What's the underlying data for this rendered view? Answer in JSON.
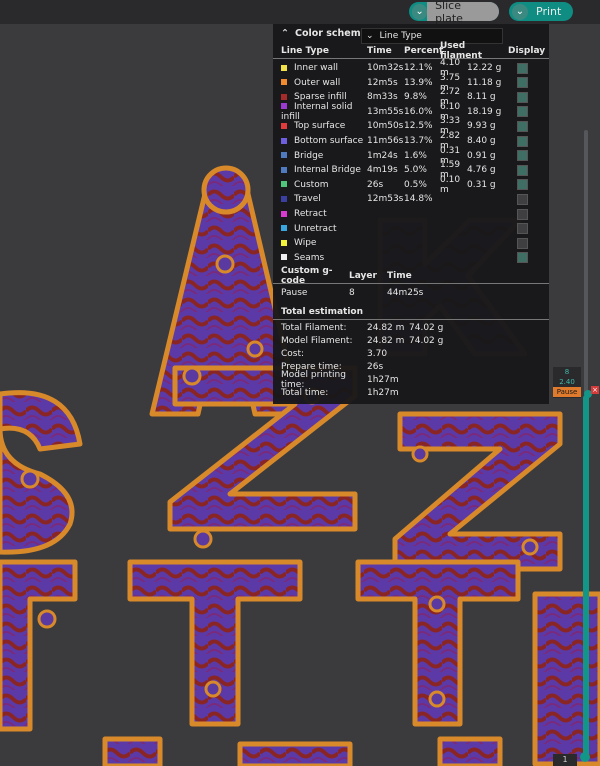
{
  "toolbar": {
    "slice_label": "Slice plate",
    "print_label": "Print",
    "accent": "#0f8d83"
  },
  "legend": {
    "title": "Color scheme",
    "selected_scheme": "Line Type",
    "headers": {
      "line_type": "Line Type",
      "time": "Time",
      "percent": "Percent",
      "used": "Used filament",
      "display": "Display"
    },
    "rows": [
      {
        "name": "Inner wall",
        "color": "#f2e24a",
        "time": "10m32s",
        "percent": "12.1%",
        "length": "4.10 m",
        "weight": "12.22 g",
        "display": true
      },
      {
        "name": "Outer wall",
        "color": "#f28a2e",
        "time": "12m5s",
        "percent": "13.9%",
        "length": "3.75 m",
        "weight": "11.18 g",
        "display": true
      },
      {
        "name": "Sparse infill",
        "color": "#a52a2a",
        "time": "8m33s",
        "percent": "9.8%",
        "length": "2.72 m",
        "weight": "8.11 g",
        "display": true
      },
      {
        "name": "Internal solid infill",
        "color": "#9b3ad0",
        "time": "13m55s",
        "percent": "16.0%",
        "length": "6.10 m",
        "weight": "18.19 g",
        "display": true
      },
      {
        "name": "Top surface",
        "color": "#e23b3b",
        "time": "10m50s",
        "percent": "12.5%",
        "length": "3.33 m",
        "weight": "9.93 g",
        "display": true
      },
      {
        "name": "Bottom surface",
        "color": "#6e5fe0",
        "time": "11m56s",
        "percent": "13.7%",
        "length": "2.82 m",
        "weight": "8.40 g",
        "display": true
      },
      {
        "name": "Bridge",
        "color": "#4f7ac0",
        "time": "1m24s",
        "percent": "1.6%",
        "length": "0.31 m",
        "weight": "0.91 g",
        "display": true
      },
      {
        "name": "Internal Bridge",
        "color": "#4f7ac0",
        "time": "4m19s",
        "percent": "5.0%",
        "length": "1.59 m",
        "weight": "4.76 g",
        "display": true
      },
      {
        "name": "Custom",
        "color": "#4ec57a",
        "time": "26s",
        "percent": "0.5%",
        "length": "0.10 m",
        "weight": "0.31 g",
        "display": true
      },
      {
        "name": "Travel",
        "color": "#3a3fa0",
        "time": "12m53s",
        "percent": "14.8%",
        "length": "",
        "weight": "",
        "display": false
      },
      {
        "name": "Retract",
        "color": "#d93bd0",
        "time": "",
        "percent": "",
        "length": "",
        "weight": "",
        "display": false
      },
      {
        "name": "Unretract",
        "color": "#3aa6e0",
        "time": "",
        "percent": "",
        "length": "",
        "weight": "",
        "display": false
      },
      {
        "name": "Wipe",
        "color": "#f2f23a",
        "time": "",
        "percent": "",
        "length": "",
        "weight": "",
        "display": false
      },
      {
        "name": "Seams",
        "color": "#eeeeee",
        "time": "",
        "percent": "",
        "length": "",
        "weight": "",
        "display": true
      }
    ],
    "custom_gcode": {
      "headers": {
        "name": "Custom g-code",
        "layer": "Layer",
        "time": "Time"
      },
      "rows": [
        {
          "name": "Pause",
          "layer": "8",
          "time": "44m25s"
        }
      ]
    },
    "total": {
      "title": "Total estimation",
      "total_filament": {
        "label": "Total Filament:",
        "length": "24.82 m",
        "weight": "74.02 g"
      },
      "model_filament": {
        "label": "Model Filament:",
        "length": "24.82 m",
        "weight": "74.02 g"
      },
      "cost": {
        "label": "Cost:",
        "value": "3.70"
      },
      "prepare_time": {
        "label": "Prepare time:",
        "value": "26s"
      },
      "model_printing_time": {
        "label": "Model printing time:",
        "value": "1h27m"
      },
      "total_time": {
        "label": "Total time:",
        "value": "1h27m"
      }
    }
  },
  "slider": {
    "top_layer": "8",
    "top_height": "2.40",
    "pause_label": "Pause",
    "bottom_layer": "1"
  }
}
